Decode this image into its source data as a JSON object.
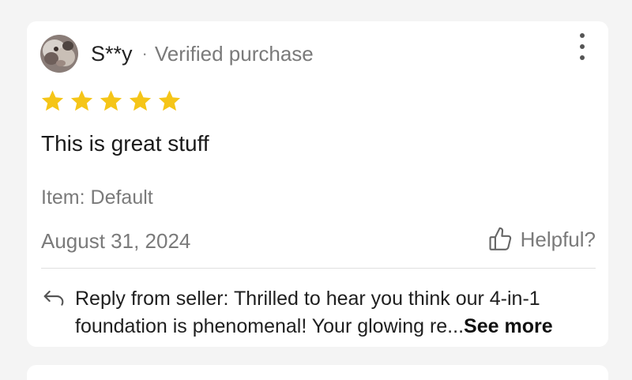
{
  "review": {
    "reviewer_name": "S**y",
    "separator": "·",
    "verified_label": "Verified purchase",
    "rating": 5,
    "rating_max": 5,
    "star_color": "#f5c518",
    "text": "This is great stuff",
    "item": "Item: Default",
    "date": "August 31, 2024",
    "helpful_label": "Helpful?",
    "more_icon": "kebab-menu-icon"
  },
  "seller_reply": {
    "icon": "reply-arrow-icon",
    "text": "Reply from seller: Thrilled to hear you think our 4-in-1 foundation is phenomenal! Your glowing re...",
    "see_more_label": "See more"
  }
}
